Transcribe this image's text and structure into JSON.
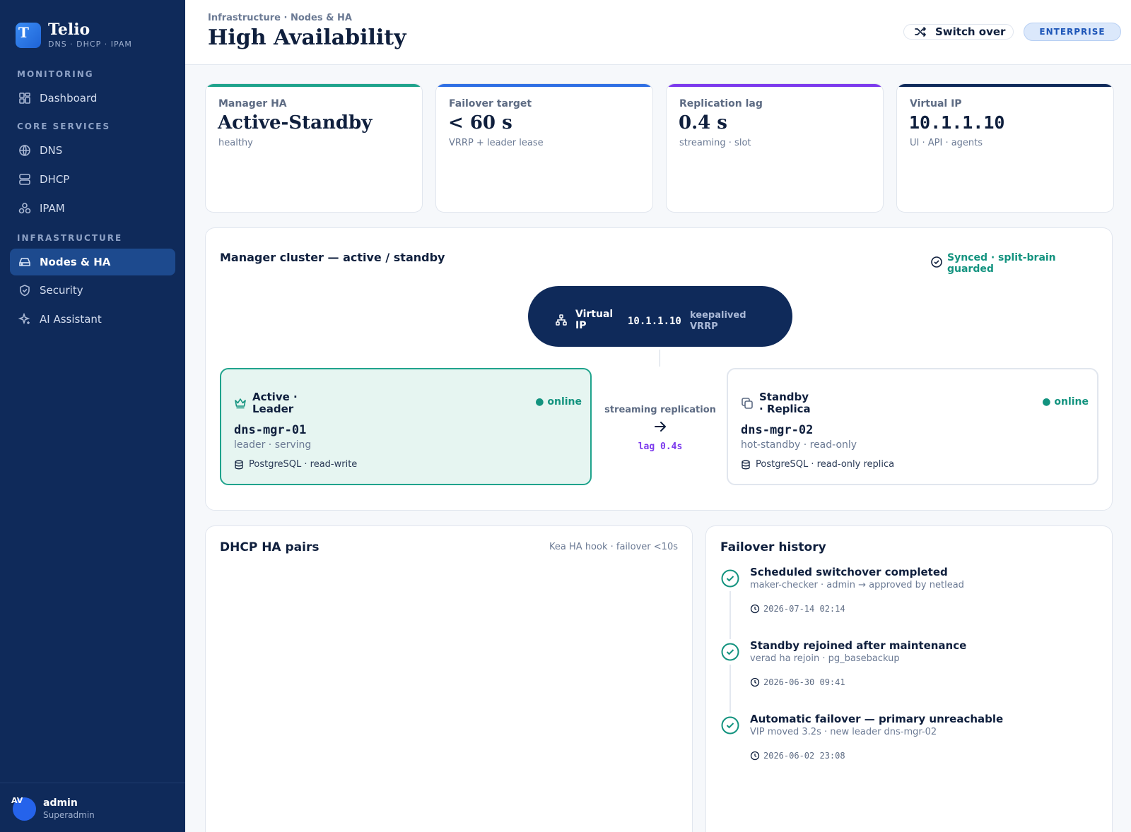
{
  "brand": {
    "logo_letter": "T",
    "name": "Telio",
    "subtitle": "DNS · DHCP · IPAM"
  },
  "sidebar": {
    "sections": [
      {
        "label": "MONITORING"
      },
      {
        "label": "CORE SERVICES"
      },
      {
        "label": "INFRASTRUCTURE"
      }
    ],
    "items": [
      {
        "label": "Dashboard",
        "icon": "dashboard-icon"
      },
      {
        "label": "DNS",
        "icon": "globe-icon"
      },
      {
        "label": "DHCP",
        "icon": "server-icon"
      },
      {
        "label": "IPAM",
        "icon": "network-icon"
      },
      {
        "label": "Nodes & HA",
        "icon": "drive-icon",
        "active": true
      },
      {
        "label": "Security",
        "icon": "shield-icon"
      },
      {
        "label": "AI Assistant",
        "icon": "sparkle-icon"
      }
    ]
  },
  "user": {
    "initials": "AV",
    "name": "admin",
    "role": "Superadmin"
  },
  "header": {
    "breadcrumb": "Infrastructure · Nodes & HA",
    "title": "High Availability",
    "switch_label": "Switch over",
    "badge": "ENTERPRISE"
  },
  "stats": [
    {
      "label": "Manager HA",
      "value": "Active-Standby",
      "sub": "healthy",
      "color": "#1fa38c"
    },
    {
      "label": "Failover target",
      "value": "< 60 s",
      "sub": "VRRP + leader lease",
      "color": "#2f6fe4"
    },
    {
      "label": "Replication lag",
      "value": "0.4 s",
      "sub": "streaming · slot",
      "color": "#7c3aed"
    },
    {
      "label": "Virtual IP",
      "value": "10.1.1.10",
      "sub": "UI · API · agents",
      "color": "#0f2a5a"
    }
  ],
  "cluster": {
    "title": "Manager cluster — active / standby",
    "sync_status": "Synced · split-brain guarded",
    "vip": {
      "label": "Virtual IP",
      "address": "10.1.1.10",
      "tech": "keepalived VRRP"
    },
    "replication": {
      "label": "streaming replication",
      "lag": "lag 0.4s"
    },
    "nodes": [
      {
        "role": "Active · Leader",
        "status": "● online",
        "host": "dns-mgr-01",
        "desc": "leader · serving",
        "db": "PostgreSQL · read-write"
      },
      {
        "role": "Standby · Replica",
        "status": "● online",
        "host": "dns-mgr-02",
        "desc": "hot-standby · read-only",
        "db": "PostgreSQL · read-only replica"
      }
    ]
  },
  "dhcp": {
    "title": "DHCP HA pairs",
    "meta": "Kea HA hook · failover <10s"
  },
  "history": {
    "title": "Failover history",
    "events": [
      {
        "title": "Scheduled switchover completed",
        "sub": "maker-checker · admin → approved by netlead",
        "time": "2026-07-14 02:14"
      },
      {
        "title": "Standby rejoined after maintenance",
        "sub": "verad ha rejoin · pg_basebackup",
        "time": "2026-06-30 09:41"
      },
      {
        "title": "Automatic failover — primary unreachable",
        "sub": "VIP moved 3.2s · new leader dns-mgr-02",
        "time": "2026-06-02 23:08"
      }
    ]
  },
  "colors": {
    "sidebar": "#0f2a5a",
    "accent": "#1fa38c",
    "primary": "#2f6fe4",
    "lag": "#7c3aed"
  }
}
